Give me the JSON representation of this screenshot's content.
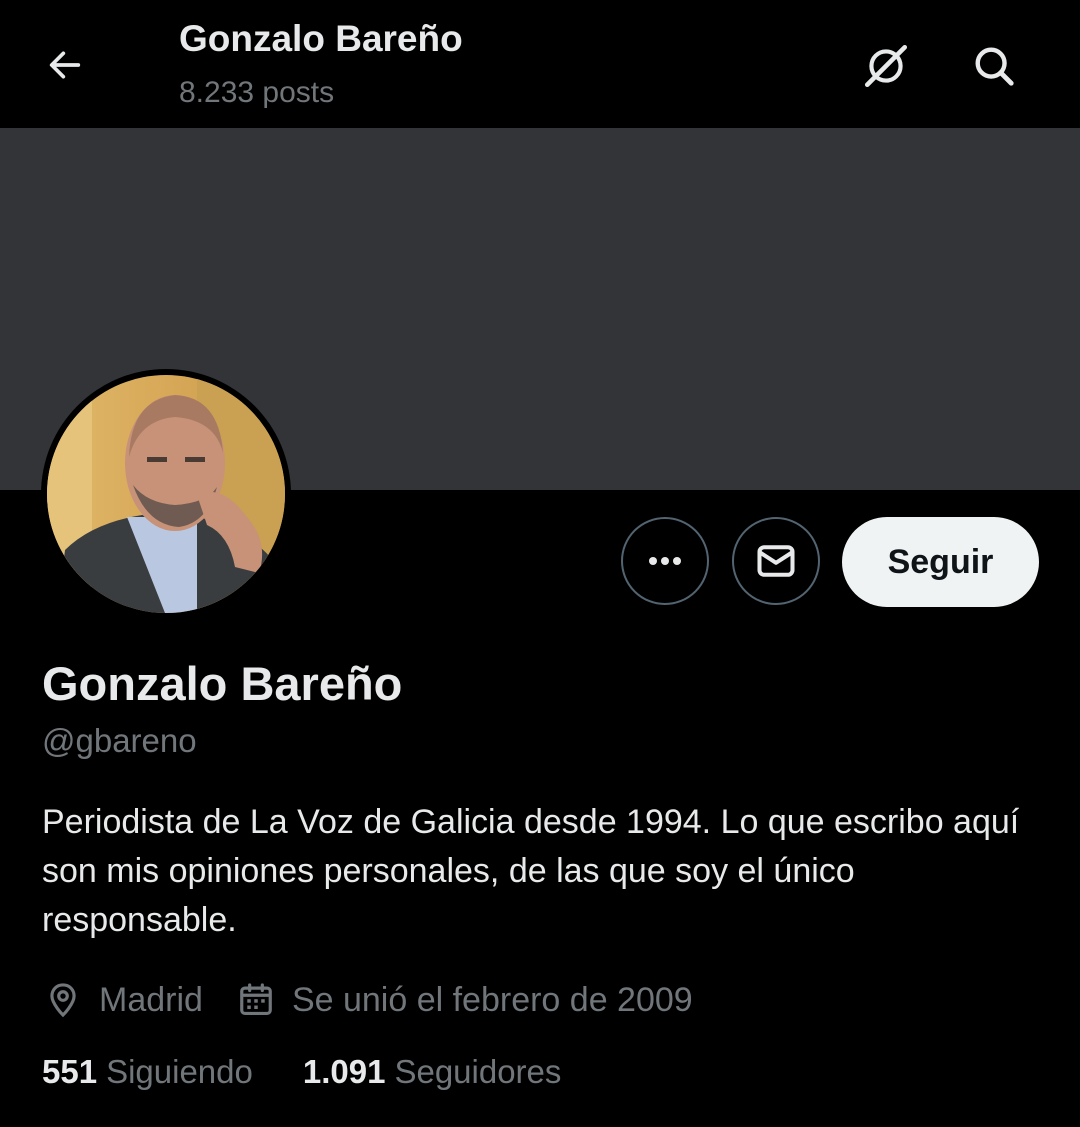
{
  "header": {
    "title": "Gonzalo Bareño",
    "subtitle": "8.233 posts"
  },
  "icons": {
    "back": "arrow-left-icon",
    "grok": "grok-icon",
    "search": "search-icon",
    "more": "more-icon",
    "message": "envelope-icon",
    "location": "location-pin-icon",
    "calendar": "calendar-icon"
  },
  "colors": {
    "background": "#000000",
    "banner": "#333438",
    "primary_text": "#e7e9ea",
    "secondary_text": "#71767b",
    "follow_bg": "#eff3f4"
  },
  "profile": {
    "name": "Gonzalo Bareño",
    "handle": "@gbareno",
    "bio": "Periodista de La Voz de Galicia desde 1994. Lo que escribo aquí son mis opiniones personales, de las que soy el único responsable.",
    "location": "Madrid",
    "joined": "Se unió el febrero de 2009"
  },
  "actions": {
    "follow_label": "Seguir"
  },
  "stats": {
    "following_count": "551",
    "following_label": "Siguiendo",
    "followers_count": "1.091",
    "followers_label": "Seguidores"
  }
}
